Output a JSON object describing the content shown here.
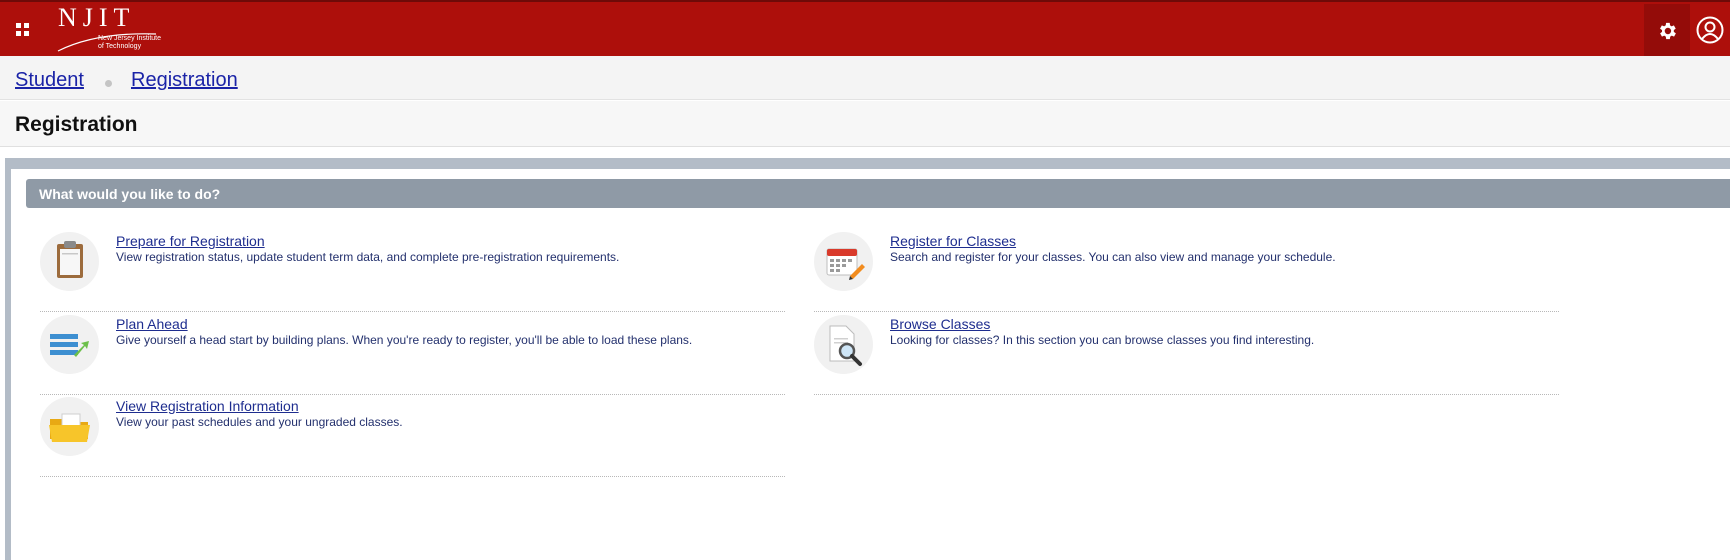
{
  "header": {
    "logo_text": "NJIT",
    "logo_subtext": "New Jersey Institute\nof Technology",
    "colors": {
      "brand": "#ad0f0b",
      "gear_bg": "#940c09"
    },
    "icons": [
      "apps-grid-icon",
      "gear-icon",
      "user-icon"
    ]
  },
  "breadcrumb": {
    "items": [
      "Student",
      "Registration"
    ]
  },
  "page": {
    "title": "Registration"
  },
  "section": {
    "title": "What would you like to do?",
    "items": [
      {
        "label": "Prepare for Registration",
        "description": "View registration status, update student term data, and complete pre-registration requirements.",
        "icon": "clipboard-icon"
      },
      {
        "label": "Register for Classes",
        "description": "Search and register for your classes. You can also view and manage your schedule.",
        "icon": "calendar-pencil-icon"
      },
      {
        "label": "Plan Ahead",
        "description": "Give yourself a head start by building plans. When you're ready to register, you'll be able to load these plans.",
        "icon": "plan-list-icon"
      },
      {
        "label": "Browse Classes",
        "description": "Looking for classes? In this section you can browse classes you find interesting.",
        "icon": "document-magnifier-icon"
      },
      {
        "label": "View Registration Information",
        "description": "View your past schedules and your ungraded classes.",
        "icon": "folder-icon"
      }
    ]
  }
}
